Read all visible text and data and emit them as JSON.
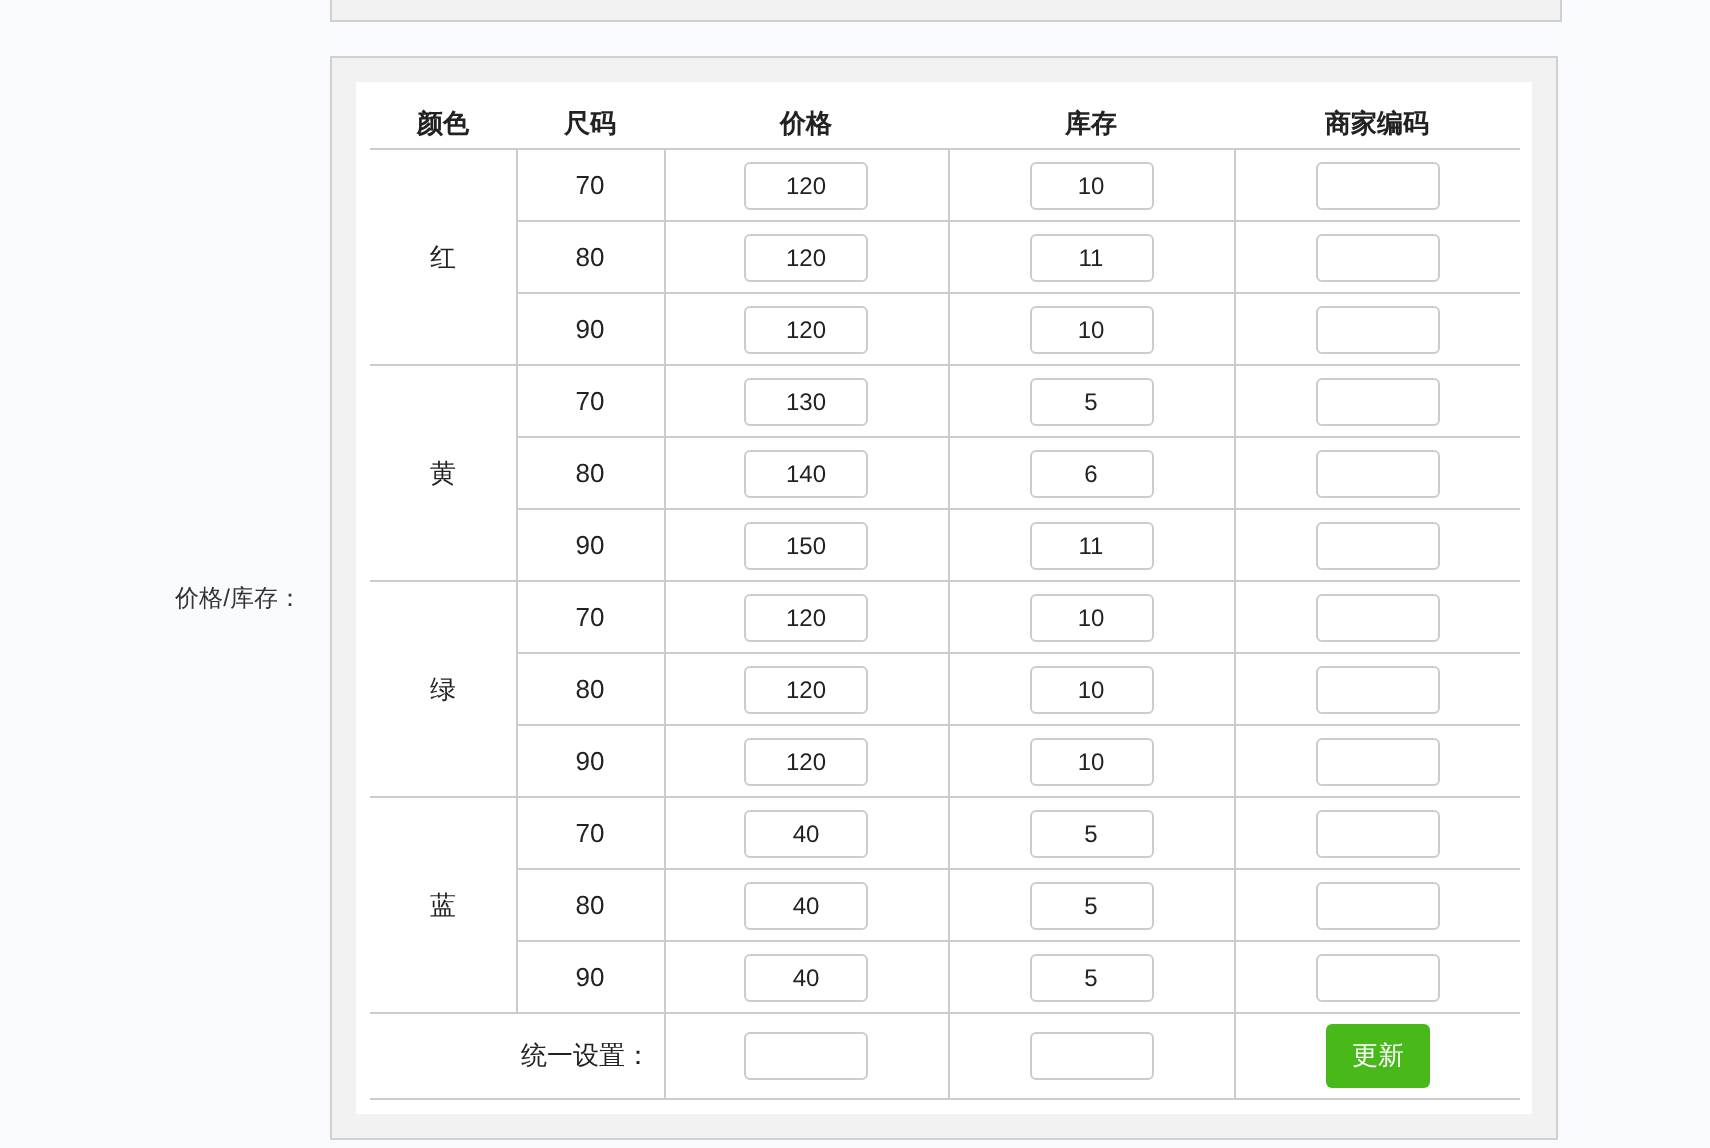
{
  "field_label": "价格/库存：",
  "columns": [
    "颜色",
    "尺码",
    "价格",
    "库存",
    "商家编码"
  ],
  "groups": [
    {
      "color_name": "红",
      "rows": [
        {
          "size": "70",
          "price": "120",
          "stock": "10",
          "code": ""
        },
        {
          "size": "80",
          "price": "120",
          "stock": "11",
          "code": ""
        },
        {
          "size": "90",
          "price": "120",
          "stock": "10",
          "code": ""
        }
      ]
    },
    {
      "color_name": "黄",
      "rows": [
        {
          "size": "70",
          "price": "130",
          "stock": "5",
          "code": ""
        },
        {
          "size": "80",
          "price": "140",
          "stock": "6",
          "code": ""
        },
        {
          "size": "90",
          "price": "150",
          "stock": "11",
          "code": ""
        }
      ]
    },
    {
      "color_name": "绿",
      "rows": [
        {
          "size": "70",
          "price": "120",
          "stock": "10",
          "code": ""
        },
        {
          "size": "80",
          "price": "120",
          "stock": "10",
          "code": ""
        },
        {
          "size": "90",
          "price": "120",
          "stock": "10",
          "code": ""
        }
      ]
    },
    {
      "color_name": "蓝",
      "rows": [
        {
          "size": "70",
          "price": "40",
          "stock": "5",
          "code": ""
        },
        {
          "size": "80",
          "price": "40",
          "stock": "5",
          "code": ""
        },
        {
          "size": "90",
          "price": "40",
          "stock": "5",
          "code": ""
        }
      ]
    }
  ],
  "batch": {
    "label": "统一设置：",
    "button": "更新"
  }
}
